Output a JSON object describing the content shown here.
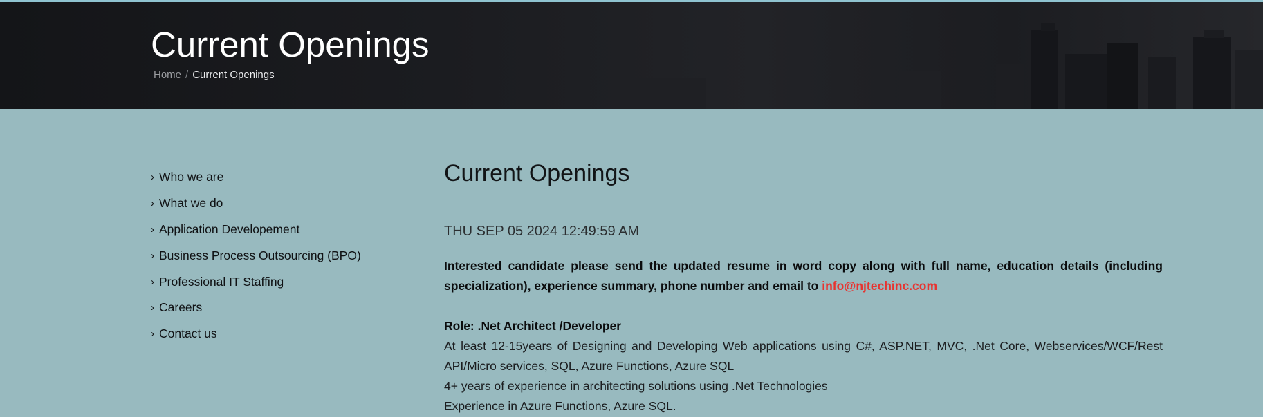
{
  "banner": {
    "title": "Current Openings",
    "breadcrumb": {
      "home": "Home",
      "separator": "/",
      "current": "Current Openings"
    }
  },
  "sidebar": {
    "items": [
      {
        "label": "Who we are"
      },
      {
        "label": "What we do"
      },
      {
        "label": "Application Developement"
      },
      {
        "label": "Business Process Outsourcing (BPO)"
      },
      {
        "label": "Professional IT Staffing"
      },
      {
        "label": "Careers"
      },
      {
        "label": "Contact us"
      }
    ],
    "chevron": "›"
  },
  "main": {
    "heading": "Current Openings",
    "date": "THU SEP 05 2024 12:49:59 AM",
    "intro_text": "Interested candidate please send the updated resume in word copy along with full name, education details (including specialization), experience summary, phone number and email to ",
    "email": "info@njtechinc.com",
    "role": "Role: .Net Architect /Developer",
    "requirements": [
      "At least 12-15years of Designing and Developing Web applications using C#, ASP.NET, MVC, .Net Core, Webservices/WCF/Rest API/Micro services, SQL, Azure Functions, Azure SQL",
      "4+ years of experience in architecting solutions using .Net Technologies",
      "Experience in Azure Functions, Azure SQL."
    ]
  },
  "colors": {
    "page_bg": "#98babf",
    "banner_bg": "#1b1c20",
    "email_link": "#e8332f",
    "top_stripe": "#8fc3d0"
  }
}
